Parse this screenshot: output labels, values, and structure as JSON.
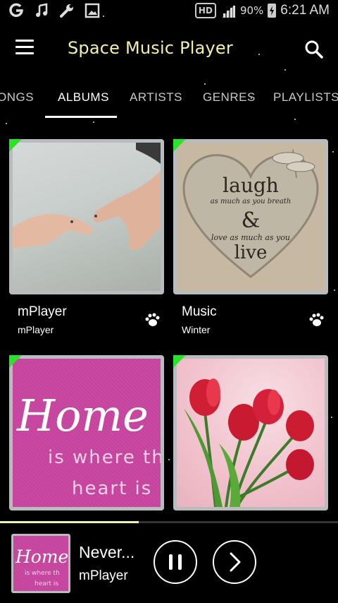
{
  "status_bar": {
    "network_badge": "HD",
    "battery_percent": "90%",
    "time": "6:21 AM",
    "icons": [
      "app-icon",
      "music-note-icon",
      "wrench-icon",
      "image-icon",
      "signal-icon",
      "battery-charging-icon"
    ]
  },
  "app_bar": {
    "title": "Space Music Player",
    "menu_icon": "hamburger-menu-icon",
    "search_icon": "search-icon"
  },
  "tabs": [
    {
      "label": "ONGS"
    },
    {
      "label": "ALBUMS",
      "active": true
    },
    {
      "label": "ARTISTS"
    },
    {
      "label": "GENRES"
    },
    {
      "label": "PLAYLISTS"
    }
  ],
  "albums": [
    {
      "title": "mPlayer",
      "artist": "mPlayer"
    },
    {
      "title": "Music",
      "artist": "Winter"
    },
    {
      "title": "",
      "artist": ""
    },
    {
      "title": "",
      "artist": ""
    }
  ],
  "art_text": {
    "laugh": {
      "line1": "laugh",
      "line2": "as much as you breath",
      "line3": "&",
      "line4": "love as much as you",
      "line5": "live"
    },
    "home": {
      "line1": "Home",
      "line2": "is where th",
      "line3": "heart is"
    },
    "mini_home": {
      "line1": "Home",
      "line2": "is where th",
      "line3": "heart is"
    }
  },
  "now_playing": {
    "title": "Never...",
    "artist": "mPlayer",
    "progress": 0.41
  },
  "colors": {
    "accent_title": "#f4f0a6",
    "corner_mark": "#2ae32a",
    "frame": "#b9bcbf"
  }
}
